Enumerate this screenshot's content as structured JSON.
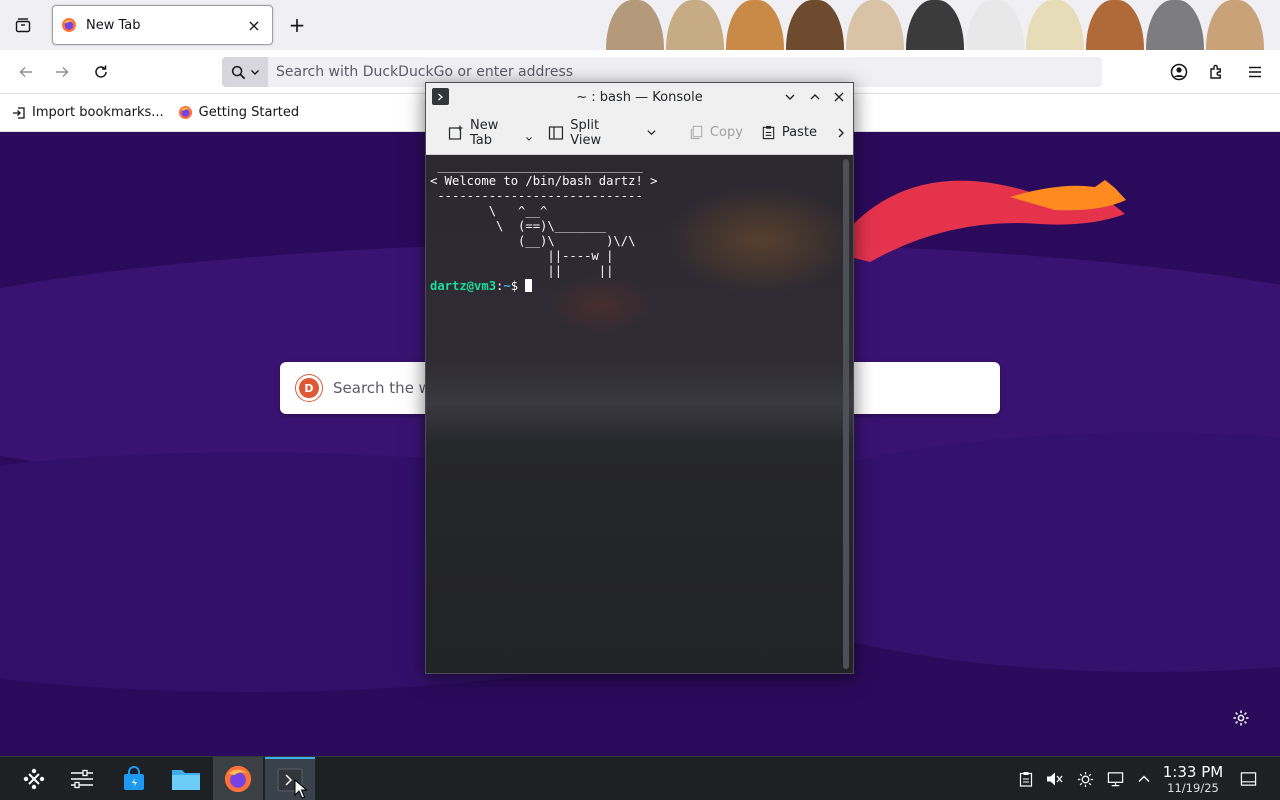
{
  "browser": {
    "tab": {
      "title": "New Tab",
      "close_glyph": "×"
    },
    "new_tab_glyph": "+",
    "urlbar_placeholder": "Search with DuckDuckGo or enter address",
    "bookmarks": [
      {
        "label": "Import bookmarks...",
        "icon": "import-icon"
      },
      {
        "label": "Getting Started",
        "icon": "firefox-icon"
      }
    ],
    "newtab_search_placeholder": "Search the web",
    "colors": {
      "page_bg": "#2b0a5c",
      "toolbar": "#f0f0f4"
    }
  },
  "konsole": {
    "title": "~ : bash — Konsole",
    "toolbar": {
      "new_tab": "New Tab",
      "split_view": "Split View",
      "copy": "Copy",
      "paste": "Paste"
    },
    "terminal_lines": [
      " ____________________________",
      "< Welcome to /bin/bash dartz! >",
      " ----------------------------",
      "        \\   ^__^",
      "         \\  (==)\\_______",
      "            (__)\\       )\\/\\",
      "                ||----w |",
      "                ||     ||"
    ],
    "prompt": {
      "user_host": "dartz@vm3",
      "separator": ":",
      "path": "~",
      "symbol": "$"
    },
    "colors": {
      "prompt_user": "#1cdc9a",
      "prompt_path": "#3daee9"
    }
  },
  "taskbar": {
    "clock_time": "1:33 PM",
    "clock_date": "11/19/25"
  }
}
